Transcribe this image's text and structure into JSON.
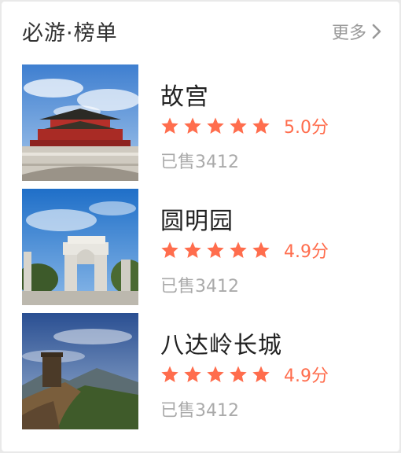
{
  "header": {
    "title": "必游·榜单",
    "more_label": "更多"
  },
  "colors": {
    "accent": "#ff6d4d",
    "text_primary": "#222222",
    "text_secondary": "#aaaaaa"
  },
  "items": [
    {
      "name": "故宫",
      "stars": 5,
      "score": "5.0分",
      "sold": "已售3412",
      "image": "forbidden-city-photo"
    },
    {
      "name": "圆明园",
      "stars": 5,
      "score": "4.9分",
      "sold": "已售3412",
      "image": "yuanmingyuan-ruins-photo"
    },
    {
      "name": "八达岭长城",
      "stars": 5,
      "score": "4.9分",
      "sold": "已售3412",
      "image": "great-wall-photo"
    }
  ]
}
